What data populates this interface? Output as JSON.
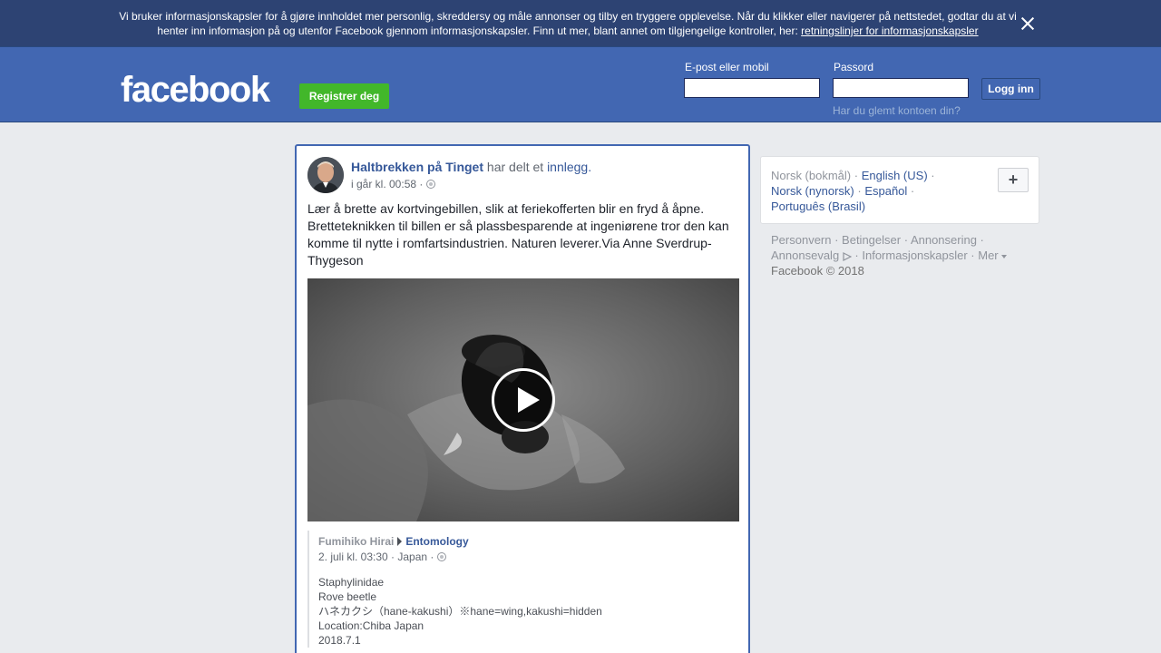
{
  "cookie_banner": {
    "text": "Vi bruker informasjonskapsler for å gjøre innholdet mer personlig, skreddersy og måle annonser og tilby en tryggere opplevelse. Når du klikker eller navigerer på nettstedet, godtar du at vi henter inn informasjon på og utenfor Facebook gjennom informasjonskapsler. Finn ut mer, blant annet om tilgjengelige kontroller, her: ",
    "link_text": "retningslinjer for informasjonskapsler"
  },
  "header": {
    "logo": "facebook",
    "register_label": "Registrer deg",
    "email_label": "E-post eller mobil",
    "password_label": "Passord",
    "login_label": "Logg inn",
    "forgot_label": "Har du glemt kontoen din?"
  },
  "post": {
    "author": "Haltbrekken på Tinget",
    "action": " har delt et ",
    "action_link": "innlegg.",
    "time": "i går kl. 00:58 ·",
    "text": "Lær å brette av kortvingebillen, slik at feriekofferten blir en fryd å åpne. Bretteteknikken til billen er så plassbesparende at ingeniørene tror den kan komme til nytte i romfartsindustrien. Naturen leverer.Via Anne Sverdrup-Thygeson",
    "shared": {
      "author": "Fumihiko Hirai",
      "group": "Entomology",
      "time": "2. juli kl. 03:30 · Japan ·",
      "lines": [
        "Staphylinidae",
        "Rove beetle",
        "ハネカクシ（hane-kakushi）※hane=wing,kakushi=hidden",
        "Location:Chiba Japan",
        "2018.7.1"
      ]
    }
  },
  "sidebar": {
    "languages": {
      "current": "Norsk (bokmål)",
      "sep": " · ",
      "english": "English (US)",
      "nynorsk": "Norsk (nynorsk)",
      "spanish": "Español",
      "portuguese": "Português (Brasil)"
    },
    "add_language": "+",
    "footer": {
      "privacy": "Personvern",
      "terms": "Betingelser",
      "advertising": "Annonsering",
      "adchoices": "Annonsevalg",
      "cookies": "Informasjonskapsler",
      "more": "Mer",
      "copyright": "Facebook © 2018"
    }
  }
}
